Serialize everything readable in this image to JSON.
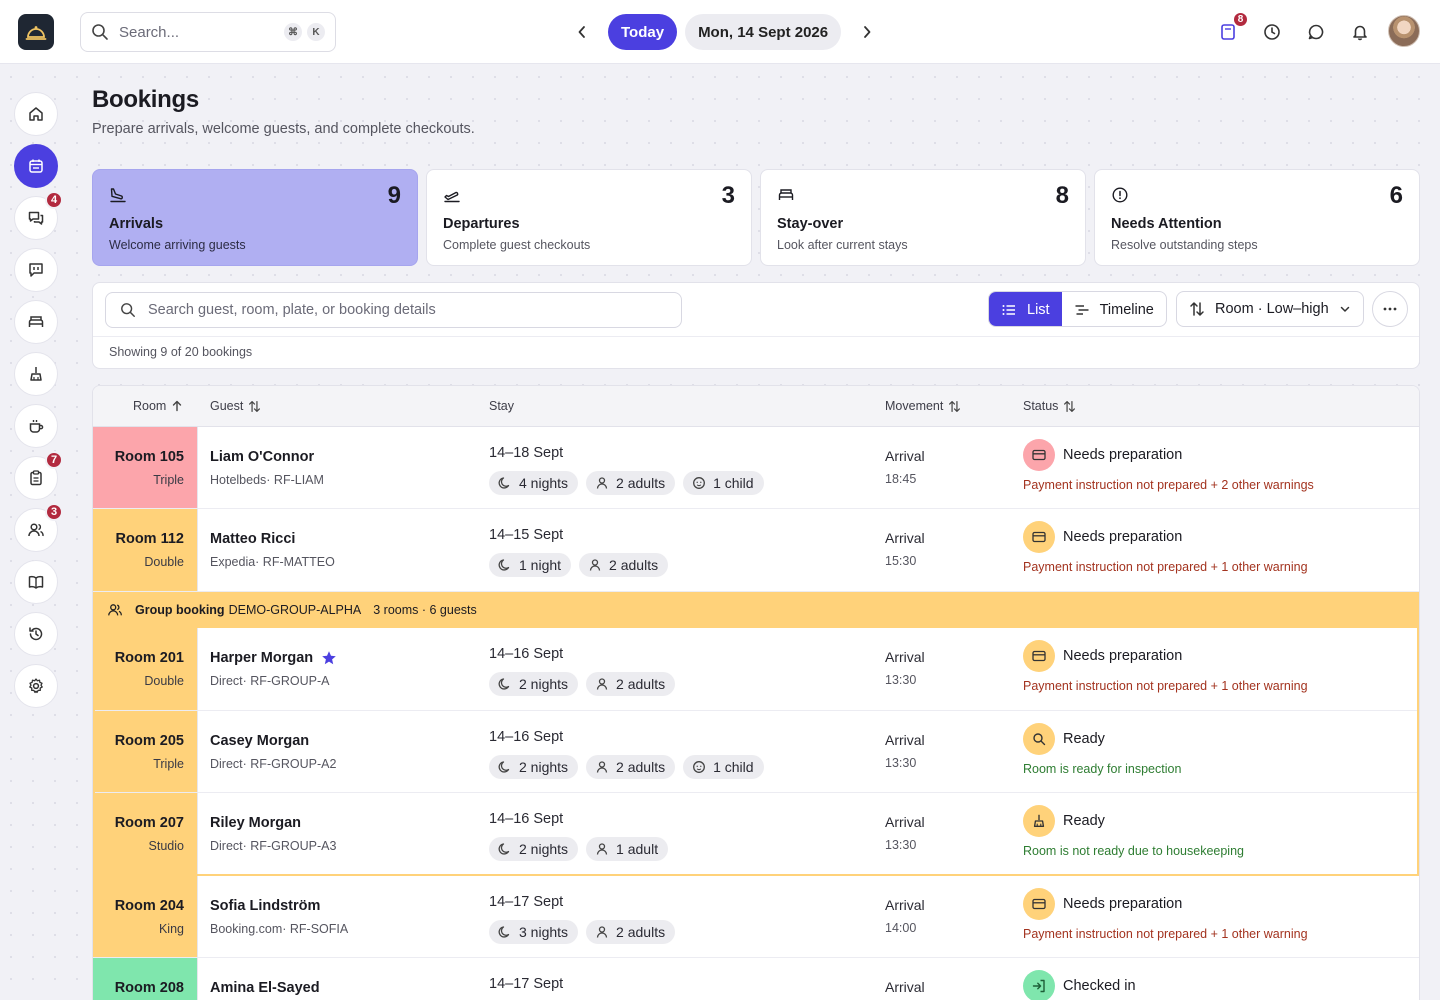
{
  "topbar": {
    "search_placeholder": "Search...",
    "shortcut_keys": [
      "⌘",
      "K"
    ],
    "today_label": "Today",
    "current_date": "Mon, 14 Sept 2026",
    "bookings_badge": "8"
  },
  "sidebar": {
    "messages_badge": "4",
    "tasks_badge": "7",
    "guests_badge": "3"
  },
  "page": {
    "title": "Bookings",
    "subtitle": "Prepare arrivals, welcome guests, and complete checkouts."
  },
  "cards": [
    {
      "title": "Arrivals",
      "subtitle": "Welcome arriving guests",
      "count": "9"
    },
    {
      "title": "Departures",
      "subtitle": "Complete guest checkouts",
      "count": "3"
    },
    {
      "title": "Stay-over",
      "subtitle": "Look after current stays",
      "count": "8"
    },
    {
      "title": "Needs Attention",
      "subtitle": "Resolve outstanding steps",
      "count": "6"
    }
  ],
  "filters": {
    "search_placeholder": "Search guest, room, plate, or booking details",
    "view_list": "List",
    "view_timeline": "Timeline",
    "sort_label": "Room · Low–high",
    "showing_text": "Showing 9 of 20 bookings"
  },
  "table": {
    "columns": {
      "room": "Room",
      "guest": "Guest",
      "stay": "Stay",
      "movement": "Movement",
      "status": "Status"
    },
    "group": {
      "title": "Group booking",
      "code": "DEMO-GROUP-ALPHA",
      "meta": "3 rooms · 6 guests"
    },
    "rows": [
      {
        "room": "Room 105",
        "type": "Triple",
        "guest": "Liam O'Connor",
        "source": "Hotelbeds· RF-LIAM",
        "dates": "14–18 Sept",
        "nights": "4 nights",
        "adults": "2 adults",
        "children": "1 child",
        "movement": "Arrival",
        "time": "18:45",
        "status": "Needs preparation",
        "detail": "Payment instruction not prepared + 2 other warnings"
      },
      {
        "room": "Room 112",
        "type": "Double",
        "guest": "Matteo Ricci",
        "source": "Expedia· RF-MATTEO",
        "dates": "14–15 Sept",
        "nights": "1 night",
        "adults": "2 adults",
        "movement": "Arrival",
        "time": "15:30",
        "status": "Needs preparation",
        "detail": "Payment instruction not prepared + 1 other warning"
      },
      {
        "room": "Room 201",
        "type": "Double",
        "guest": "Harper Morgan",
        "source": "Direct· RF-GROUP-A",
        "dates": "14–16 Sept",
        "nights": "2 nights",
        "adults": "2 adults",
        "movement": "Arrival",
        "time": "13:30",
        "status": "Needs preparation",
        "detail": "Payment instruction not prepared + 1 other warning"
      },
      {
        "room": "Room 205",
        "type": "Triple",
        "guest": "Casey Morgan",
        "source": "Direct· RF-GROUP-A2",
        "dates": "14–16 Sept",
        "nights": "2 nights",
        "adults": "2 adults",
        "children": "1 child",
        "movement": "Arrival",
        "time": "13:30",
        "status": "Ready",
        "detail": "Room is ready for inspection"
      },
      {
        "room": "Room 207",
        "type": "Studio",
        "guest": "Riley Morgan",
        "source": "Direct· RF-GROUP-A3",
        "dates": "14–16 Sept",
        "nights": "2 nights",
        "adults": "1 adult",
        "movement": "Arrival",
        "time": "13:30",
        "status": "Ready",
        "detail": "Room is not ready due to housekeeping"
      },
      {
        "room": "Room 204",
        "type": "King",
        "guest": "Sofia Lindström",
        "source": "Booking.com· RF-SOFIA",
        "dates": "14–17 Sept",
        "nights": "3 nights",
        "adults": "2 adults",
        "movement": "Arrival",
        "time": "14:00",
        "status": "Needs preparation",
        "detail": "Payment instruction not prepared + 1 other warning"
      },
      {
        "room": "Room 208",
        "guest": "Amina El-Sayed",
        "dates": "14–17 Sept",
        "movement": "Arrival",
        "status": "Checked in"
      }
    ]
  },
  "colors": {
    "accent": "#4b3fe0",
    "room_red": "#fca5ab",
    "room_amber": "#ffd27a",
    "room_green": "#7fe6ad",
    "group_banner": "#ffd27a",
    "warning_text": "#a3331f",
    "success_text": "#2e7d32"
  }
}
